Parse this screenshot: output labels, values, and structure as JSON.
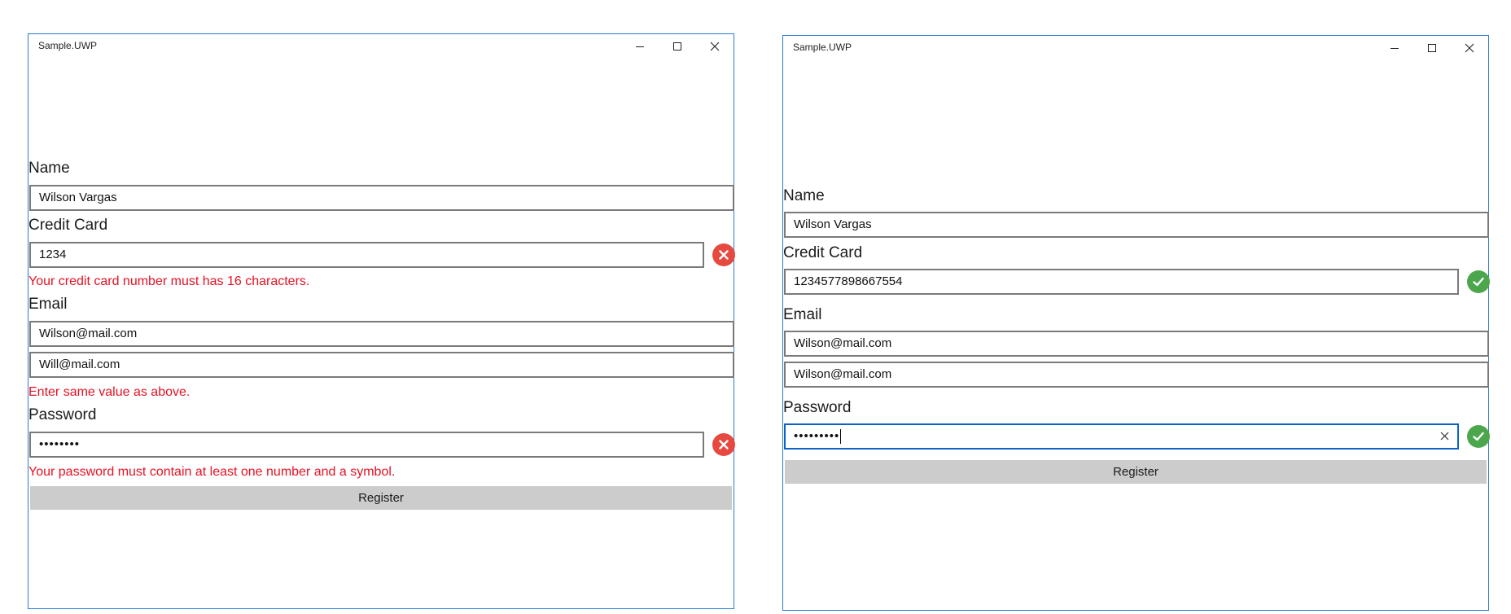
{
  "left_window": {
    "title": "Sample.UWP",
    "name_label": "Name",
    "name_value": "Wilson Vargas",
    "card_label": "Credit Card",
    "card_value": "1234",
    "card_error": "Your credit card number must has 16 characters.",
    "email_label": "Email",
    "email_value": "Wilson@mail.com",
    "email_confirm_value": "Will@mail.com",
    "email_error": "Enter same value as above.",
    "password_label": "Password",
    "password_value": "••••••••",
    "password_error": "Your password must contain at least one number and a symbol.",
    "register_label": "Register"
  },
  "right_window": {
    "title": "Sample.UWP",
    "name_label": "Name",
    "name_value": "Wilson Vargas",
    "card_label": "Credit Card",
    "card_value": "1234577898667554",
    "email_label": "Email",
    "email_value": "Wilson@mail.com",
    "email_confirm_value": "Wilson@mail.com",
    "password_label": "Password",
    "password_value": "•••••••••",
    "register_label": "Register"
  },
  "icons": {
    "invalid": "error-x-icon",
    "valid": "checkmark-icon",
    "clear": "clear-x-icon"
  },
  "colors": {
    "error_text": "#e81123",
    "error_icon": "#e5493f",
    "valid_icon": "#4ca64c",
    "window_border": "#2b7bd1",
    "button_bg": "#cccccc"
  }
}
